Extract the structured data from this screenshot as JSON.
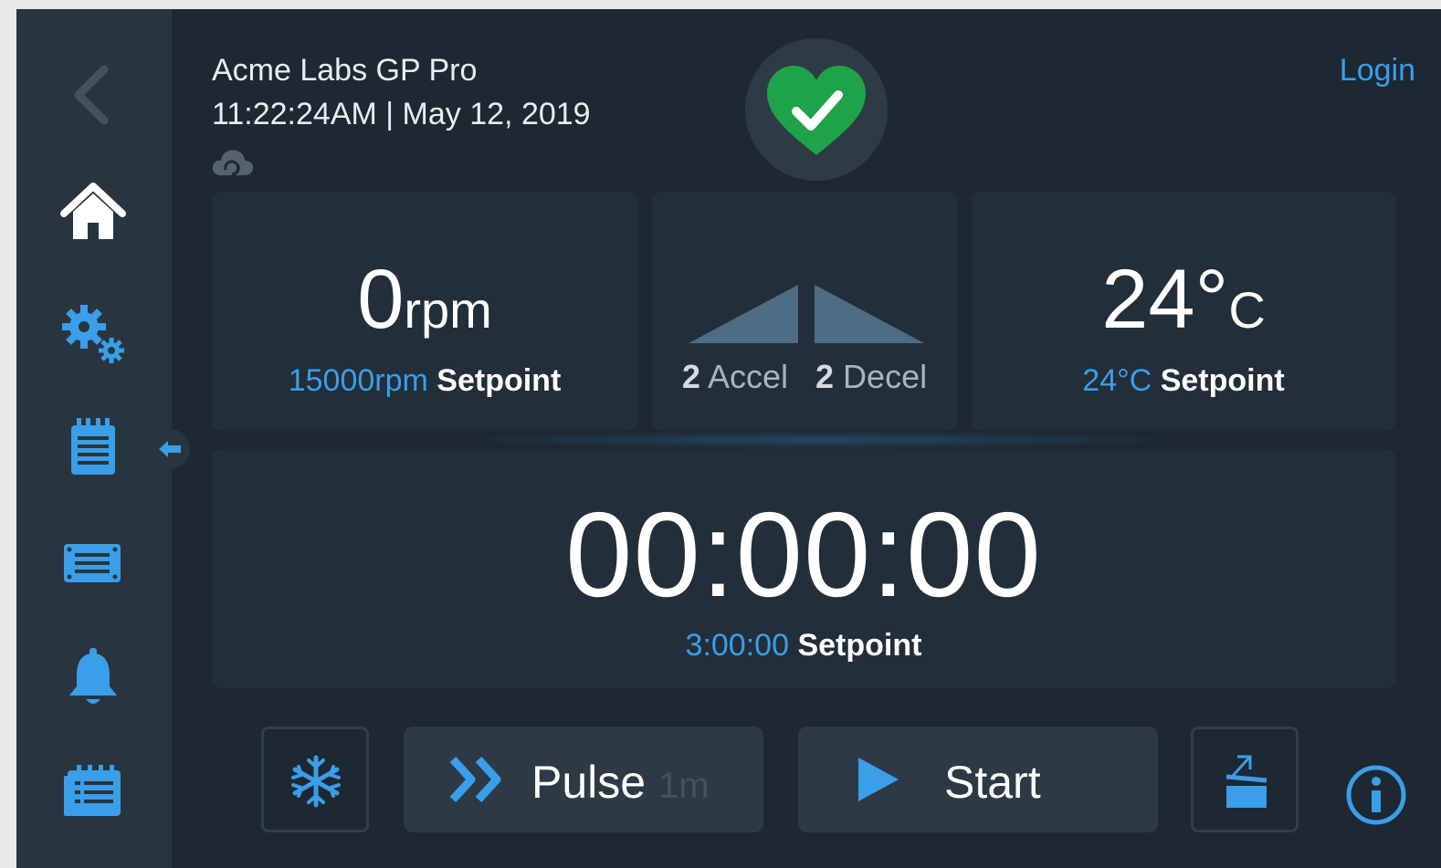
{
  "header": {
    "device_name": "Acme Labs GP Pro",
    "datetime": "11:22:24AM | May 12, 2019",
    "login_label": "Login"
  },
  "speed": {
    "value": "0",
    "unit": "rpm",
    "setpoint_value": "15000rpm",
    "setpoint_label": "Setpoint"
  },
  "accel": {
    "accel_value": "2",
    "accel_label": "Accel",
    "decel_value": "2",
    "decel_label": "Decel"
  },
  "temperature": {
    "value": "24",
    "unit_degree": "°",
    "unit_c": "C",
    "setpoint_value": "24°C",
    "setpoint_label": "Setpoint"
  },
  "timer": {
    "value": "00:00:00",
    "setpoint_value": "3:00:00",
    "setpoint_label": "Setpoint"
  },
  "buttons": {
    "pulse_label": "Pulse",
    "pulse_duration": "1m",
    "start_label": "Start"
  },
  "icons": {
    "sidebar": [
      "back-chevron-icon",
      "home-icon",
      "settings-gears-icon",
      "run-list-icon",
      "rotor-icon",
      "alarm-bell-icon",
      "log-icon"
    ],
    "health": "heart-check-icon",
    "cloud": "cloud-sync-icon",
    "buttons": [
      "snowflake-icon",
      "double-chevron-icon",
      "play-icon",
      "lid-open-icon",
      "info-icon"
    ]
  },
  "colors": {
    "accent": "#3a9ee8",
    "background": "#1d2833",
    "panel": "#222e39",
    "sidebar": "#28353f",
    "health_ok": "#1fa34a"
  }
}
